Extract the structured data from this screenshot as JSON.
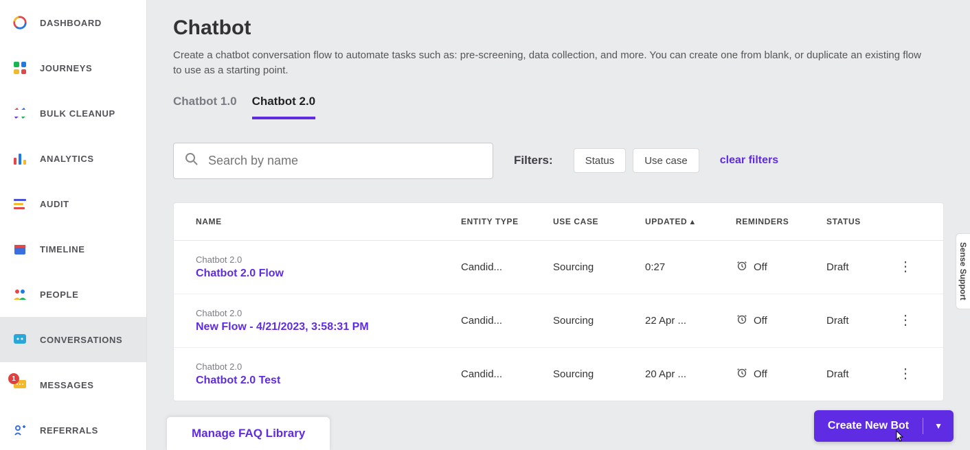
{
  "sidebar": {
    "items": [
      {
        "label": "DASHBOARD"
      },
      {
        "label": "JOURNEYS"
      },
      {
        "label": "BULK CLEANUP"
      },
      {
        "label": "ANALYTICS"
      },
      {
        "label": "AUDIT"
      },
      {
        "label": "TIMELINE"
      },
      {
        "label": "PEOPLE"
      },
      {
        "label": "CONVERSATIONS"
      },
      {
        "label": "MESSAGES",
        "badge": "1"
      },
      {
        "label": "REFERRALS"
      }
    ]
  },
  "page": {
    "title": "Chatbot",
    "description": "Create a chatbot conversation flow to automate tasks such as: pre-screening, data collection, and more. You can create one from blank, or duplicate an existing flow to use as a starting point."
  },
  "tabs": [
    {
      "label": "Chatbot 1.0"
    },
    {
      "label": "Chatbot 2.0"
    }
  ],
  "search": {
    "placeholder": "Search by name"
  },
  "filters": {
    "label": "Filters:",
    "status_label": "Status",
    "usecase_label": "Use case",
    "clear_label": "clear filters"
  },
  "columns": {
    "name": "NAME",
    "entity": "ENTITY TYPE",
    "usecase": "USE CASE",
    "updated": "UPDATED",
    "reminders": "REMINDERS",
    "status": "STATUS"
  },
  "rows": [
    {
      "version": "Chatbot 2.0",
      "name": "Chatbot 2.0 Flow",
      "entity": "Candid...",
      "usecase": "Sourcing",
      "updated": "0:27",
      "reminders": "Off",
      "status": "Draft"
    },
    {
      "version": "Chatbot 2.0",
      "name": "New Flow - 4/21/2023, 3:58:31 PM",
      "entity": "Candid...",
      "usecase": "Sourcing",
      "updated": "22 Apr ...",
      "reminders": "Off",
      "status": "Draft"
    },
    {
      "version": "Chatbot 2.0",
      "name": "Chatbot 2.0 Test",
      "entity": "Candid...",
      "usecase": "Sourcing",
      "updated": "20 Apr ...",
      "reminders": "Off",
      "status": "Draft"
    }
  ],
  "faq_button": "Manage FAQ Library",
  "create_button": "Create New Bot",
  "support_tab": "Sense Support"
}
